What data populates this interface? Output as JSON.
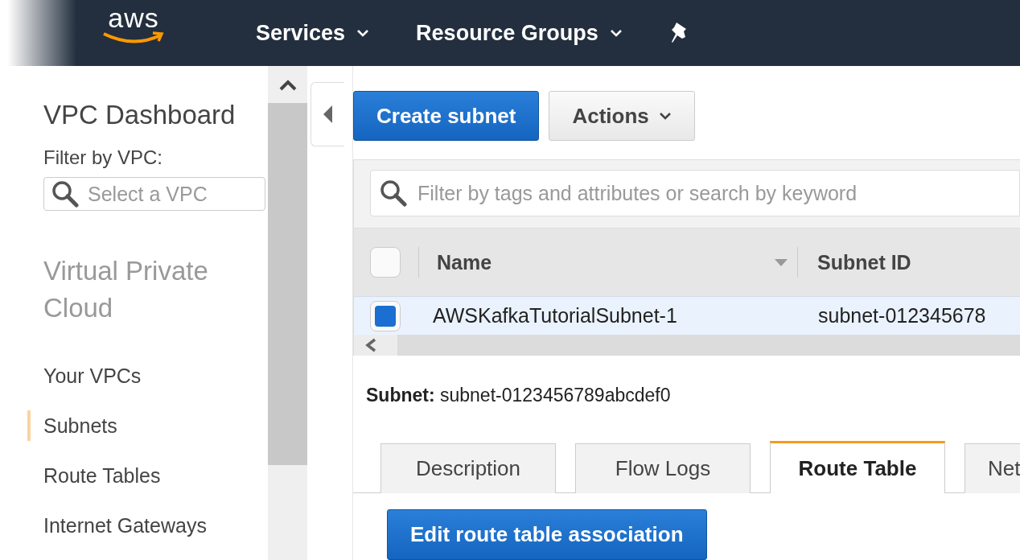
{
  "nav": {
    "logo": "aws",
    "menus": [
      {
        "label": "Services"
      },
      {
        "label": "Resource Groups"
      }
    ]
  },
  "sidebar": {
    "title": "VPC Dashboard",
    "filter_label": "Filter by VPC:",
    "filter": {
      "placeholder": "Select a VPC"
    },
    "section": "Virtual Private Cloud",
    "items": [
      {
        "label": "Your VPCs",
        "selected": false
      },
      {
        "label": "Subnets",
        "selected": true
      },
      {
        "label": "Route Tables",
        "selected": false
      },
      {
        "label": "Internet Gateways",
        "selected": false
      }
    ]
  },
  "toolbar": {
    "create_button": "Create subnet",
    "actions_button": "Actions"
  },
  "search": {
    "placeholder": "Filter by tags and attributes or search by keyword"
  },
  "table": {
    "header_checked": false,
    "columns": [
      "Name",
      "Subnet ID"
    ],
    "rows": [
      {
        "selected": true,
        "cells": [
          "AWSKafkaTutorialSubnet-1",
          "subnet-012345678"
        ]
      }
    ]
  },
  "detail": {
    "label": "Subnet:",
    "value": "subnet-0123456789abcdef0"
  },
  "tabs": [
    {
      "label": "Description",
      "selected": false
    },
    {
      "label": "Flow Logs",
      "selected": false
    },
    {
      "label": "Route Table",
      "selected": true
    },
    {
      "label": "Net",
      "selected": false
    }
  ],
  "edit_button": "Edit route table association"
}
